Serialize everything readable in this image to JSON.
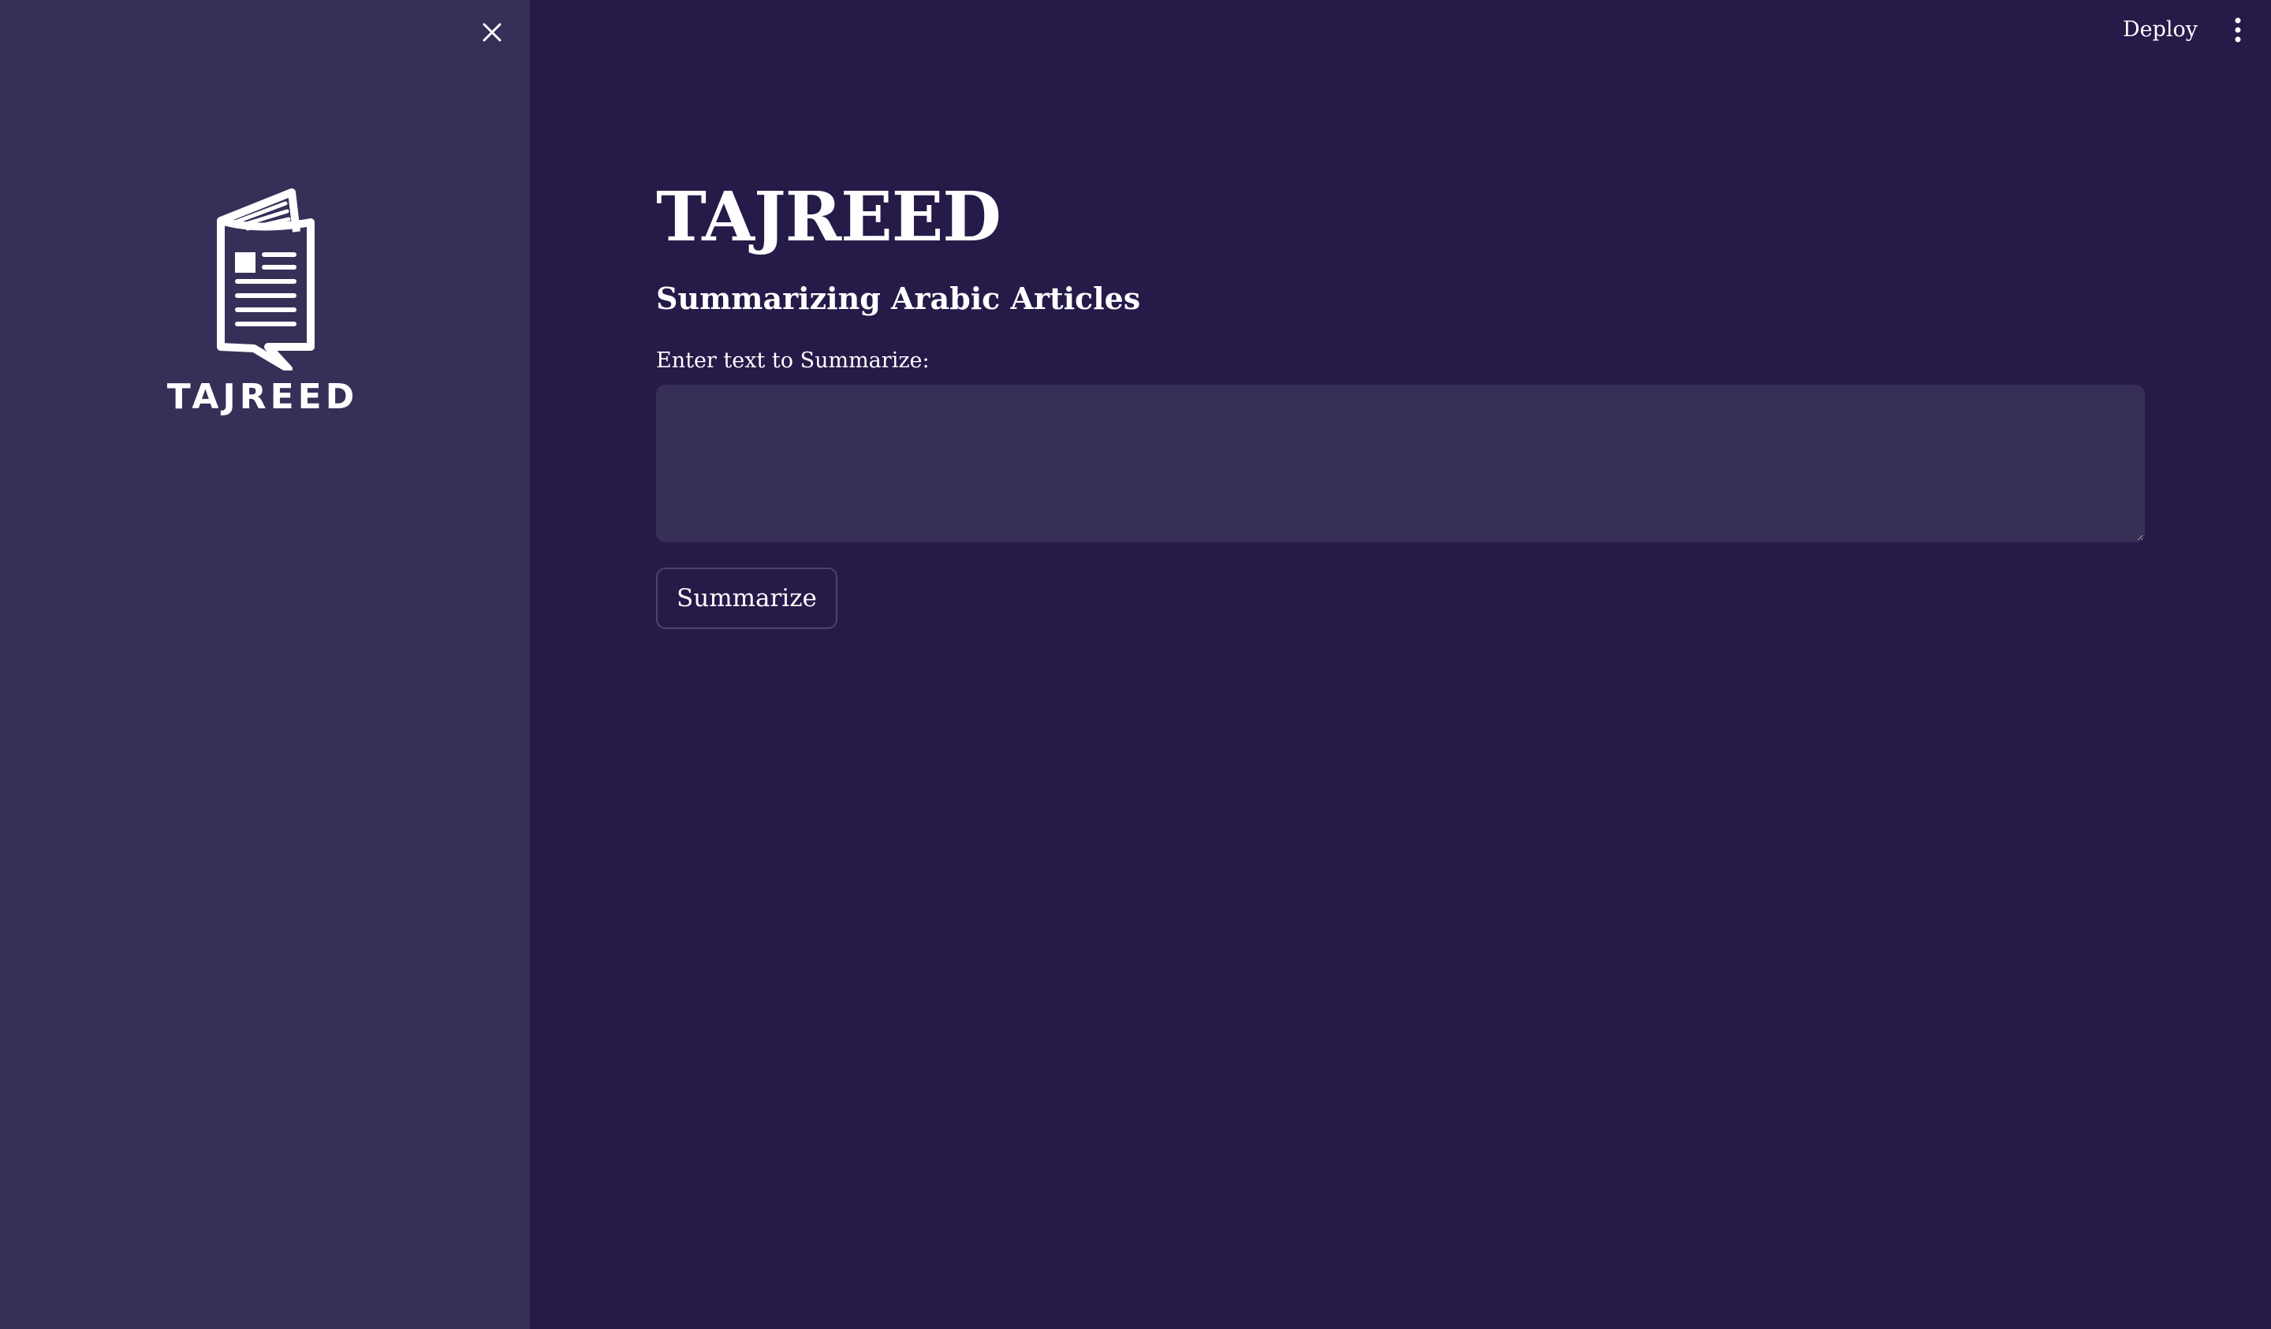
{
  "sidebar": {
    "close_icon": "close-icon",
    "logo": {
      "icon": "newspaper-icon",
      "text": "TAJREED"
    }
  },
  "topbar": {
    "deploy_label": "Deploy",
    "menu_icon": "vertical-ellipsis-icon"
  },
  "main": {
    "title": "TAJREED",
    "subtitle": "Summarizing Arabic Articles",
    "input": {
      "label": "Enter text to Summarize:",
      "value": "",
      "placeholder": ""
    },
    "summarize_label": "Summarize"
  },
  "colors": {
    "background": "#251a48",
    "sidebar": "#382f58",
    "text": "#ffffff",
    "button_border": "#4e4472"
  }
}
